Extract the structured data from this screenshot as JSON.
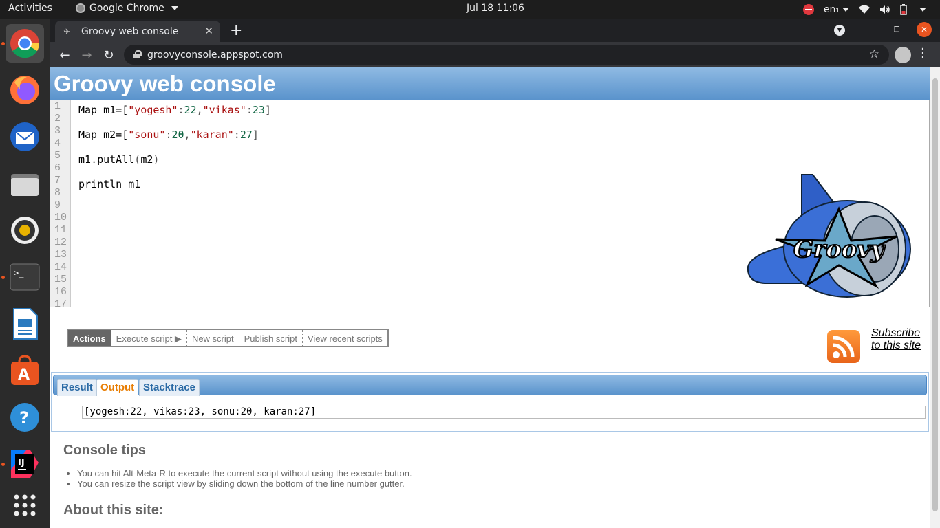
{
  "topbar": {
    "activities": "Activities",
    "app_name": "Google Chrome",
    "clock": "Jul 18  11:06",
    "lang": "en₁"
  },
  "dock": {
    "items": [
      {
        "name": "google-chrome",
        "icon": "chrome-icon"
      },
      {
        "name": "firefox",
        "icon": "firefox-icon"
      },
      {
        "name": "thunderbird",
        "icon": "thunderbird-icon"
      },
      {
        "name": "files",
        "icon": "files-icon"
      },
      {
        "name": "rhythmbox",
        "icon": "rhythmbox-icon"
      },
      {
        "name": "terminal",
        "icon": "terminal-icon"
      },
      {
        "name": "libreoffice-writer",
        "icon": "writer-icon"
      },
      {
        "name": "ubuntu-software",
        "icon": "software-icon"
      },
      {
        "name": "help",
        "icon": "help-icon"
      },
      {
        "name": "intellij-idea",
        "icon": "intellij-icon"
      },
      {
        "name": "show-applications",
        "icon": "app-grid-icon"
      }
    ]
  },
  "browser": {
    "tab_title": "Groovy web console",
    "new_tab": "+",
    "url": "groovyconsole.appspot.com"
  },
  "page": {
    "title": "Groovy web console",
    "gutter": [
      "1",
      "2",
      "3",
      "4",
      "5",
      "6",
      "7",
      "8",
      "9",
      "10",
      "11",
      "12",
      "13",
      "14",
      "15",
      "16",
      "17"
    ],
    "actions": {
      "header": "Actions",
      "execute": "Execute script ▶",
      "new": "New script",
      "publish": "Publish script",
      "recent": "View recent scripts"
    },
    "subscribe": "Subscribe to this site",
    "logo_text": "Groovy",
    "result_tabs": {
      "result": "Result",
      "output": "Output",
      "stacktrace": "Stacktrace"
    },
    "output_text": "[yogesh:22, vikas:23, sonu:20, karan:27]",
    "tips_title": "Console tips",
    "tips": [
      "You can hit Alt-Meta-R to execute the current script without using the execute button.",
      "You can resize the script view by sliding down the bottom of the line number gutter."
    ],
    "about_title": "About this site:"
  },
  "code": {
    "line1": {
      "a": "Map m1=[",
      "s1": "\"yogesh\"",
      "c1": ":",
      "n1": "22",
      "cm": ",",
      "s2": "\"vikas\"",
      "c2": ":",
      "n2": "23",
      "end": "]"
    },
    "line3": {
      "a": "Map m2=[",
      "s1": "\"sonu\"",
      "c1": ":",
      "n1": "20",
      "cm": ",",
      "s2": "\"karan\"",
      "c2": ":",
      "n2": "27",
      "end": "]"
    },
    "line5": {
      "a": "m1",
      "b": ".",
      "c": "putAll",
      "d": "(",
      "e": "m2",
      "f": ")"
    },
    "line7": "println m1"
  }
}
